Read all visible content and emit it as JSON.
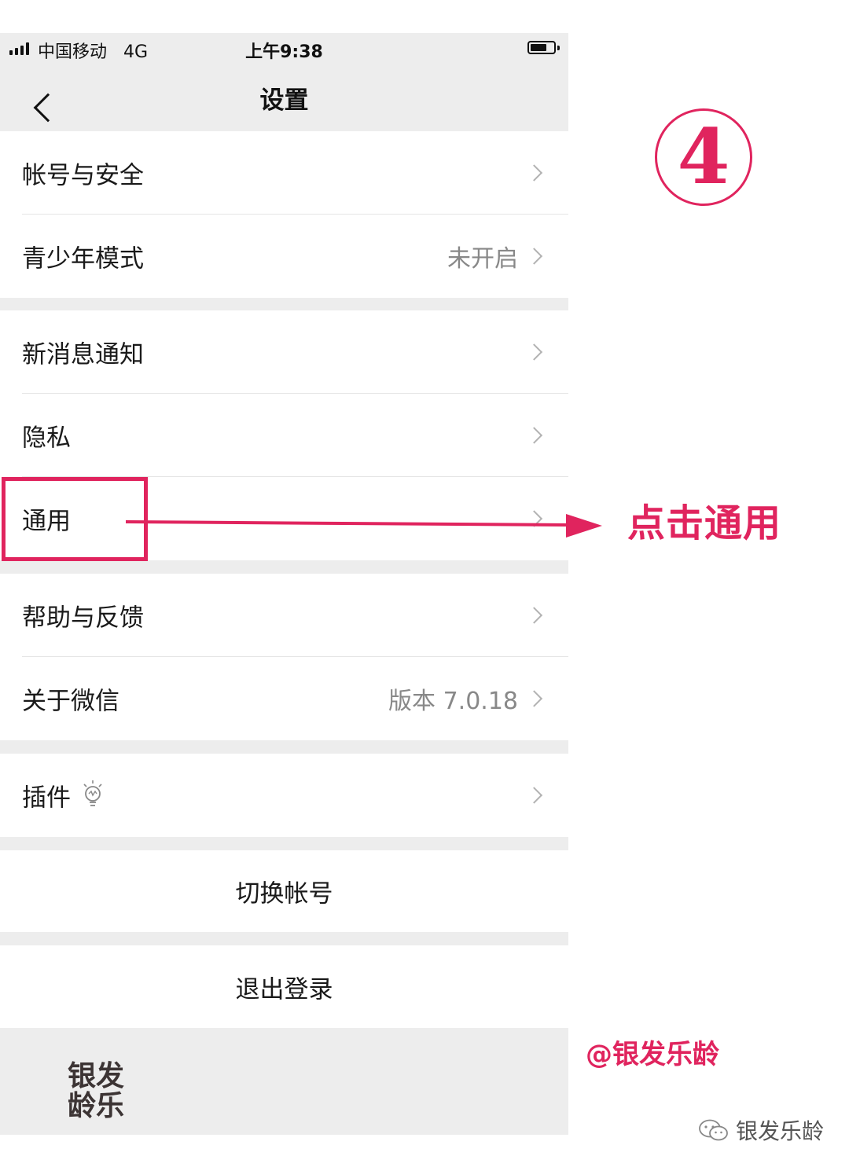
{
  "status_bar": {
    "carrier": "中国移动",
    "network": "4G",
    "time": "上午9:38"
  },
  "nav": {
    "title": "设置"
  },
  "settings": {
    "account_security": "帐号与安全",
    "youth_mode": {
      "label": "青少年模式",
      "value": "未开启"
    },
    "new_message_notify": "新消息通知",
    "privacy": "隐私",
    "general": "通用",
    "help_feedback": "帮助与反馈",
    "about_wechat": {
      "label": "关于微信",
      "value": "版本 7.0.18"
    },
    "plugins": "插件",
    "switch_account": "切换帐号",
    "logout": "退出登录"
  },
  "annotations": {
    "step_number": "4",
    "instruction": "点击通用",
    "author_handle": "@银发乐龄",
    "stamp_text": "银发龄乐",
    "wechat_account": "银发乐龄",
    "accent_color": "#e0245e"
  }
}
